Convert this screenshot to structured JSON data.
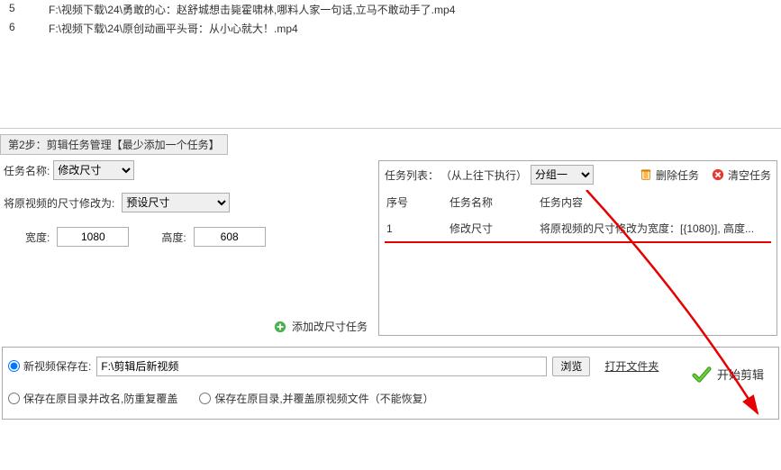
{
  "files": [
    {
      "idx": "5",
      "path": "F:\\视频下载\\24\\勇敢的心：赵舒城想击毙霍啸林,哪料人家一句话,立马不敢动手了.mp4"
    },
    {
      "idx": "6",
      "path": "F:\\视频下载\\24\\原创动画平头哥：从小心就大！.mp4"
    }
  ],
  "step_header": "第2步：剪辑任务管理【最少添加一个任务】",
  "left": {
    "task_name_label": "任务名称:",
    "task_name_value": "修改尺寸",
    "src_label": "将原视频的尺寸修改为:",
    "preset_value": "预设尺寸",
    "width_label": "宽度:",
    "width_value": "1080",
    "height_label": "高度:",
    "height_value": "608",
    "add_task_label": "添加改尺寸任务"
  },
  "right": {
    "list_label": "任务列表：",
    "exec_order": "（从上往下执行）",
    "group_value": "分组一",
    "delete_label": "删除任务",
    "clear_label": "清空任务",
    "cols": {
      "no": "序号",
      "name": "任务名称",
      "content": "任务内容"
    },
    "row": {
      "no": "1",
      "name": "修改尺寸",
      "content": "将原视频的尺寸修改为宽度：[{1080}], 高度..."
    }
  },
  "bottom": {
    "save_to_label": "新视频保存在:",
    "save_path": "F:\\剪辑后新视频",
    "browse_label": "浏览",
    "open_folder_label": "打开文件夹",
    "opt2": "保存在原目录并改名,防重复覆盖",
    "opt3": "保存在原目录,并覆盖原视频文件（不能恢复）",
    "start_label": "开始剪辑"
  }
}
